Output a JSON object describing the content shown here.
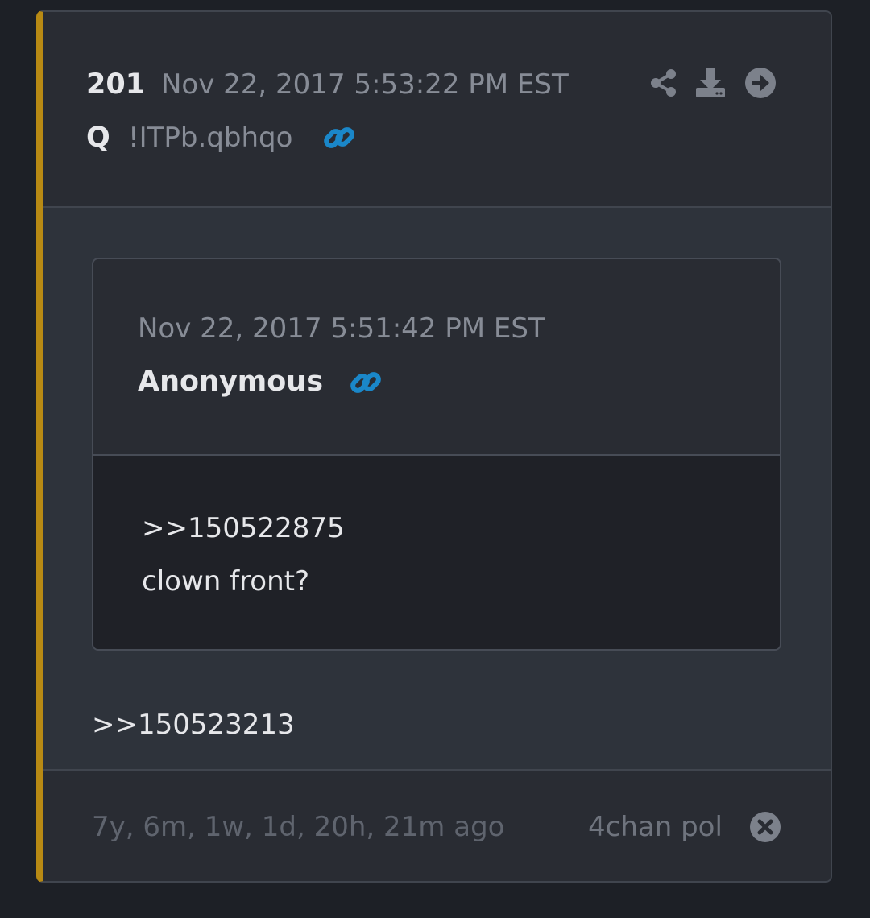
{
  "post": {
    "number": "201",
    "date": "Nov 22, 2017 5:53:22 PM EST",
    "author": "Q",
    "tripcode": "!ITPb.qbhqo",
    "accent_color": "#b88a14",
    "link_color": "#1a87c9",
    "actions": [
      "share-icon",
      "download-icon",
      "arrow-right-circle-icon"
    ]
  },
  "quoted": {
    "date": "Nov 22, 2017 5:51:42 PM EST",
    "author": "Anonymous",
    "lines": [
      ">>150522875",
      "clown front?"
    ]
  },
  "body": {
    "lines": [
      ">>150523213"
    ]
  },
  "footer": {
    "age": "7y, 6m, 1w, 1d, 20h, 21m ago",
    "source": "4chan pol",
    "close_icon": "close-circle-icon"
  }
}
